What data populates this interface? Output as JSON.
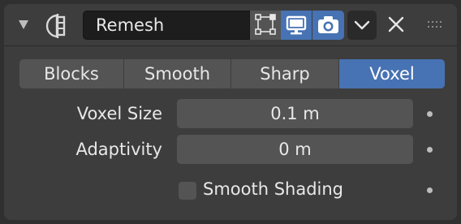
{
  "header": {
    "modifier_name": "Remesh",
    "icons": {
      "collapse": "disclosure-triangle-down-icon",
      "modifier": "remesh-modifier-icon",
      "edit_mode": "edit-mode-cage-icon",
      "viewport": "monitor-icon",
      "render": "camera-icon",
      "dropdown": "chevron-down-icon",
      "delete": "close-x-icon",
      "drag": "drag-handle-dots-icon"
    },
    "toggles": {
      "show_in_edit_mode": false,
      "show_in_viewport": true,
      "show_in_render": true
    }
  },
  "modes": {
    "items": [
      "Blocks",
      "Smooth",
      "Sharp",
      "Voxel"
    ],
    "selected": "Voxel"
  },
  "properties": {
    "voxel_size": {
      "label": "Voxel Size",
      "value": "0.1 m"
    },
    "adaptivity": {
      "label": "Adaptivity",
      "value": "0 m"
    },
    "smooth_shading": {
      "label": "Smooth Shading",
      "checked": false
    }
  },
  "colors": {
    "panel_bg": "#3d3d3d",
    "window_bg": "#303030",
    "field_bg": "#545454",
    "name_field_bg": "#1d1d1d",
    "accent": "#4772b3",
    "text": "#e8e8e8"
  }
}
